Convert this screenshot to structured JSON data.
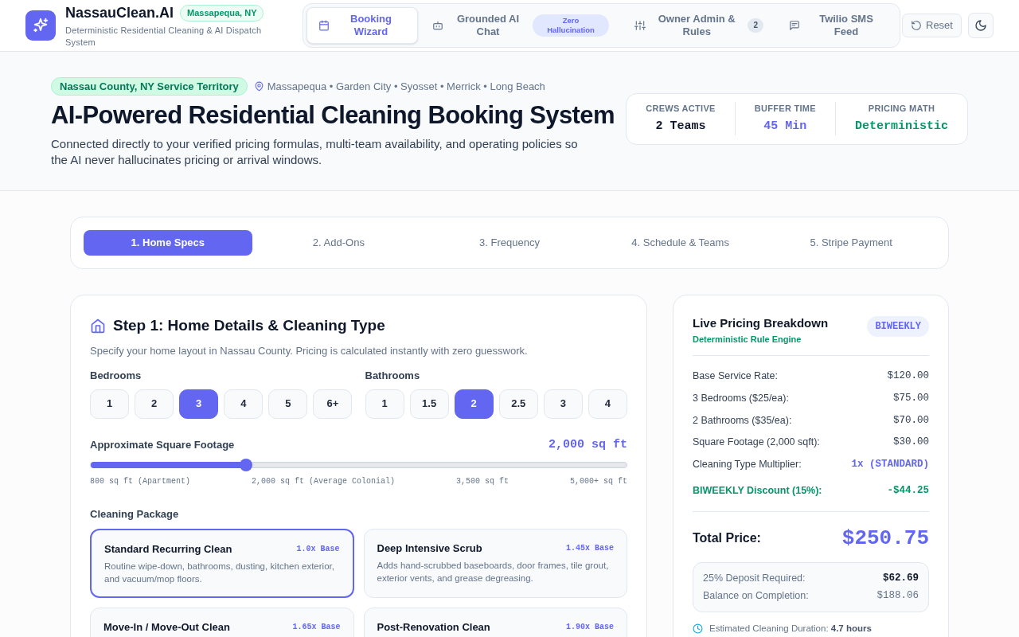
{
  "header": {
    "brand": "NassauClean.AI",
    "location": "Massapequa, NY",
    "subtitle": "Deterministic Residential Cleaning & AI Dispatch System",
    "tabs": [
      {
        "label": "Booking Wizard",
        "selected": true
      },
      {
        "label": "Grounded AI Chat",
        "selected": false,
        "badge": "Zero Hallucination"
      },
      {
        "label": "Owner Admin & Rules",
        "selected": false,
        "badge": "2"
      },
      {
        "label": "Twilio SMS Feed",
        "selected": false
      }
    ],
    "reset": "Reset"
  },
  "hero": {
    "territory": "Nassau County, NY Service Territory",
    "towns": "Massapequa • Garden City • Syosset • Merrick • Long Beach",
    "title": "AI-Powered Residential Cleaning Booking System",
    "description": "Connected directly to your verified pricing formulas, multi-team availability, and operating policies so the AI never hallucinates pricing or arrival windows.",
    "stats": [
      {
        "label": "CREWS ACTIVE",
        "value": "2 Teams",
        "color": "#0f172a"
      },
      {
        "label": "BUFFER TIME",
        "value": "45 Min",
        "color": "#6366f1"
      },
      {
        "label": "PRICING MATH",
        "value": "Deterministic",
        "color": "#059669"
      }
    ]
  },
  "steps": [
    {
      "label": "1. Home Specs",
      "selected": true
    },
    {
      "label": "2. Add-Ons",
      "selected": false
    },
    {
      "label": "3. Frequency",
      "selected": false
    },
    {
      "label": "4. Schedule & Teams",
      "selected": false
    },
    {
      "label": "5. Stripe Payment",
      "selected": false
    }
  ],
  "home": {
    "title": "Step 1: Home Details & Cleaning Type",
    "description": "Specify your home layout in Nassau County. Pricing is calculated instantly with zero guesswork.",
    "bedrooms": {
      "label": "Bedrooms",
      "options": [
        {
          "label": "1",
          "selected": false
        },
        {
          "label": "2",
          "selected": false
        },
        {
          "label": "3",
          "selected": true
        },
        {
          "label": "4",
          "selected": false
        },
        {
          "label": "5",
          "selected": false
        },
        {
          "label": "6+",
          "selected": false
        }
      ]
    },
    "bathrooms": {
      "label": "Bathrooms",
      "options": [
        {
          "label": "1",
          "selected": false
        },
        {
          "label": "1.5",
          "selected": false
        },
        {
          "label": "2",
          "selected": true
        },
        {
          "label": "2.5",
          "selected": false
        },
        {
          "label": "3",
          "selected": false
        },
        {
          "label": "4",
          "selected": false
        }
      ]
    },
    "footage": {
      "label": "Approximate Square Footage",
      "reading": "2,000 sq ft",
      "level": 0.29,
      "ticks": [
        "800 sq ft (Apartment)",
        "2,000 sq ft (Average Colonial)",
        "3,500 sq ft",
        "5,000+ sq ft"
      ]
    },
    "package": {
      "label": "Cleaning Package",
      "options": [
        {
          "name": "Standard Recurring Clean",
          "multiplier": "1.0x Base",
          "description": "Routine wipe-down, bathrooms, dusting, kitchen exterior, and vacuum/mop floors.",
          "selected": true
        },
        {
          "name": "Deep Intensive Scrub",
          "multiplier": "1.45x Base",
          "description": "Adds hand-scrubbed baseboards, door frames, tile grout, exterior vents, and grease degreasing.",
          "selected": false
        },
        {
          "name": "Move-In / Move-Out Clean",
          "multiplier": "1.65x Base",
          "selected": false
        },
        {
          "name": "Post-Renovation Clean",
          "multiplier": "1.90x Base",
          "selected": false
        }
      ]
    }
  },
  "pricing": {
    "title": "Live Pricing Breakdown",
    "subtitle": "Deterministic Rule Engine",
    "badge": "BIWEEKLY",
    "lines": [
      {
        "label": "Base Service Rate:",
        "value": "$120.00",
        "kind": "normal"
      },
      {
        "label": "3 Bedrooms ($25/ea):",
        "value": "$75.00",
        "kind": "normal"
      },
      {
        "label": "2 Bathrooms ($35/ea):",
        "value": "$70.00",
        "kind": "normal"
      },
      {
        "label": "Square Footage (2,000 sqft):",
        "value": "$30.00",
        "kind": "normal"
      },
      {
        "label": "Cleaning Type Multiplier:",
        "value": "1x (STANDARD)",
        "kind": "accent"
      },
      {
        "label": "BIWEEKLY Discount (15%):",
        "value": "-$44.25",
        "kind": "discount"
      }
    ],
    "total_label": "Total Price:",
    "total_value": "$250.75",
    "payments": [
      {
        "label": "25% Deposit Required:",
        "value": "$62.69",
        "kind": "strong"
      },
      {
        "label": "Balance on Completion:",
        "value": "$188.06",
        "kind": "muted"
      }
    ],
    "duration_label": "Estimated Cleaning Duration:",
    "duration_value": "4.7 hours"
  }
}
